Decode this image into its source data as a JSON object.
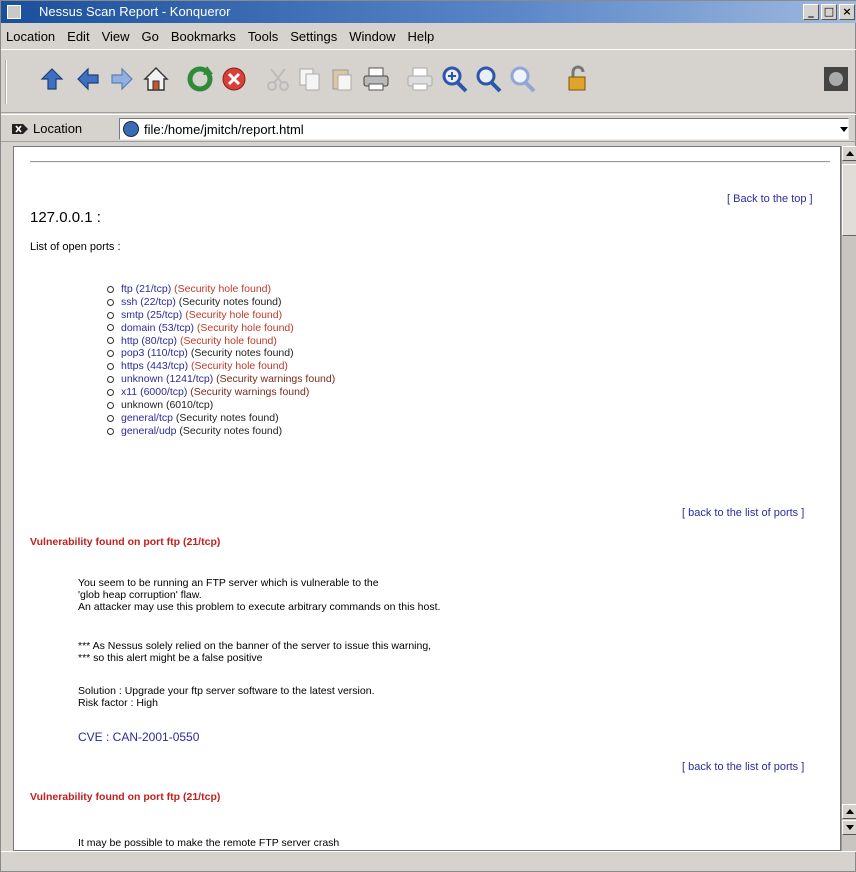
{
  "window": {
    "title": "Nessus Scan Report - Konqueror",
    "buttons": [
      "_",
      "□",
      "×"
    ]
  },
  "menubar": [
    "Location",
    "Edit",
    "View",
    "Go",
    "Bookmarks",
    "Tools",
    "Settings",
    "Window",
    "Help"
  ],
  "toolbar": {
    "icons": [
      "up-arrow-icon",
      "back-arrow-icon",
      "forward-arrow-icon",
      "home-icon",
      "reload-icon",
      "stop-icon",
      "cut-icon",
      "copy-icon",
      "paste-icon",
      "print-icon",
      "print-frame-icon",
      "zoom-fit-icon",
      "zoom-in-icon",
      "zoom-out-icon",
      "lock-icon"
    ]
  },
  "location": {
    "label": "Location",
    "url": "file:/home/jmitch/report.html"
  },
  "report": {
    "back_to_top": "[ Back to the top ]",
    "host": "127.0.0.1 :",
    "open_ports_label": "List of open ports :",
    "ports": [
      {
        "port": "ftp (21/tcp)",
        "status": "(Security hole found)",
        "severity": "hole"
      },
      {
        "port": "ssh (22/tcp)",
        "status": "(Security notes found)",
        "severity": "note"
      },
      {
        "port": "smtp (25/tcp)",
        "status": "(Security hole found)",
        "severity": "hole"
      },
      {
        "port": "domain (53/tcp)",
        "status": "(Security hole found)",
        "severity": "hole"
      },
      {
        "port": "http (80/tcp)",
        "status": "(Security hole found)",
        "severity": "hole"
      },
      {
        "port": "pop3 (110/tcp)",
        "status": "(Security notes found)",
        "severity": "note"
      },
      {
        "port": "https (443/tcp)",
        "status": "(Security hole found)",
        "severity": "hole"
      },
      {
        "port": "unknown (1241/tcp)",
        "status": "(Security warnings found)",
        "severity": "warning"
      },
      {
        "port": "x11 (6000/tcp)",
        "status": "(Security warnings found)",
        "severity": "warning"
      },
      {
        "port": "unknown (6010/tcp)",
        "status": "",
        "severity": "none"
      },
      {
        "port": "general/tcp",
        "status": "(Security notes found)",
        "severity": "note"
      },
      {
        "port": "general/udp",
        "status": "(Security notes found)",
        "severity": "note"
      }
    ],
    "back_to_ports": "[ back to the list of ports ]",
    "vuln1": {
      "heading": "Vulnerability found on port ftp (21/tcp)",
      "lines": [
        "You seem to be running an FTP server which is vulnerable to the",
        "'glob heap corruption' flaw.",
        "An attacker may use this problem to execute arbitrary commands on this host."
      ],
      "note_lines": [
        "*** As Nessus solely relied on the banner of the server to issue this warning,",
        "*** so this alert might be a false positive"
      ],
      "solution": "Solution : Upgrade your ftp server software to the latest version.",
      "risk": "Risk factor : High",
      "cve": "CVE : CAN-2001-0550"
    },
    "vuln2": {
      "heading": "Vulnerability found on port ftp (21/tcp)",
      "line": "It may be possible to make the remote FTP server crash"
    }
  },
  "colors": {
    "link": "#2b2b9c",
    "hole": "#c0392b",
    "heading": "#c0211f",
    "titlebar": "#1a4f9c"
  }
}
